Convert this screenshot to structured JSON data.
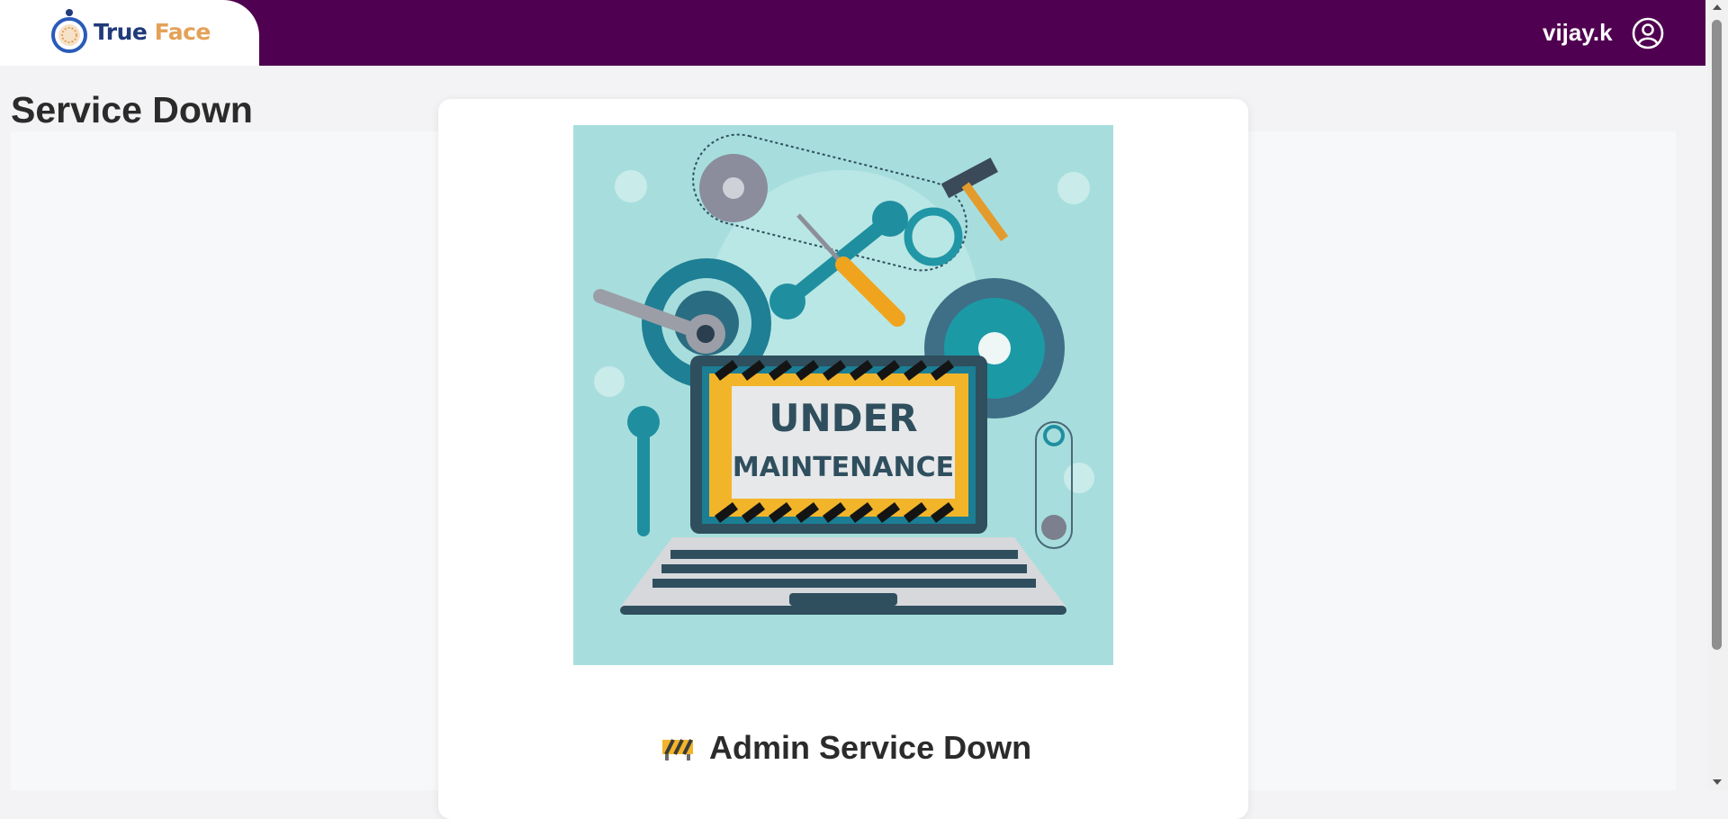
{
  "app": {
    "logo_word1": "True",
    "logo_word2": "Face",
    "brand_color": "#4f0050",
    "accent_color": "#e3a158"
  },
  "header": {
    "username": "vijay.k",
    "user_icon": "user-circle-icon"
  },
  "page": {
    "title": "Service Down"
  },
  "card": {
    "illustration_line1": "UNDER",
    "illustration_line2": "MAINTENANCE",
    "heading_icon": "construction-barrier-icon",
    "heading": "Admin Service Down"
  }
}
